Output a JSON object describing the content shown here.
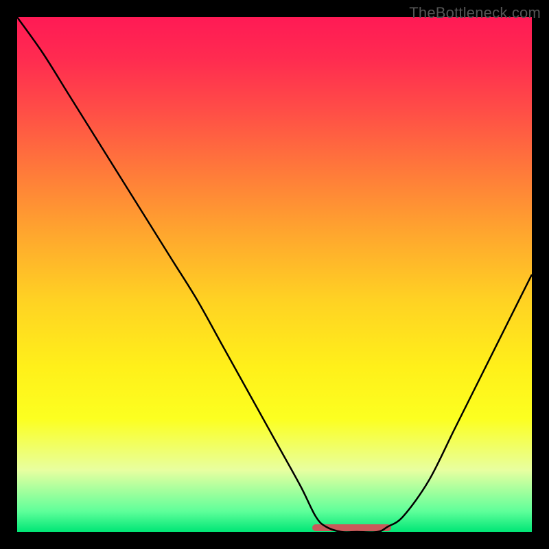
{
  "watermark": "TheBottleneck.com",
  "chart_data": {
    "type": "line",
    "title": "",
    "xlabel": "",
    "ylabel": "",
    "xlim": [
      0,
      100
    ],
    "ylim": [
      0,
      100
    ],
    "grid": false,
    "legend": false,
    "background_gradient": {
      "direction": "vertical",
      "stops": [
        {
          "pos": 0,
          "color": "#ff1a55"
        },
        {
          "pos": 50,
          "color": "#ffd223"
        },
        {
          "pos": 100,
          "color": "#00e676"
        }
      ]
    },
    "series": [
      {
        "name": "bottleneck-curve",
        "x": [
          0,
          5,
          10,
          15,
          20,
          25,
          30,
          35,
          40,
          45,
          50,
          55,
          58,
          60,
          63,
          66,
          70,
          72,
          75,
          80,
          85,
          90,
          95,
          100
        ],
        "y": [
          100,
          93,
          85,
          77,
          69,
          61,
          53,
          45,
          36,
          27,
          18,
          9,
          3,
          1,
          0,
          0,
          0,
          1,
          3,
          10,
          20,
          30,
          40,
          50
        ]
      },
      {
        "name": "optimal-range-marker",
        "x": [
          58,
          72
        ],
        "y": [
          0.5,
          0.5
        ]
      }
    ],
    "optimal_range": {
      "start": 58,
      "end": 72
    }
  }
}
